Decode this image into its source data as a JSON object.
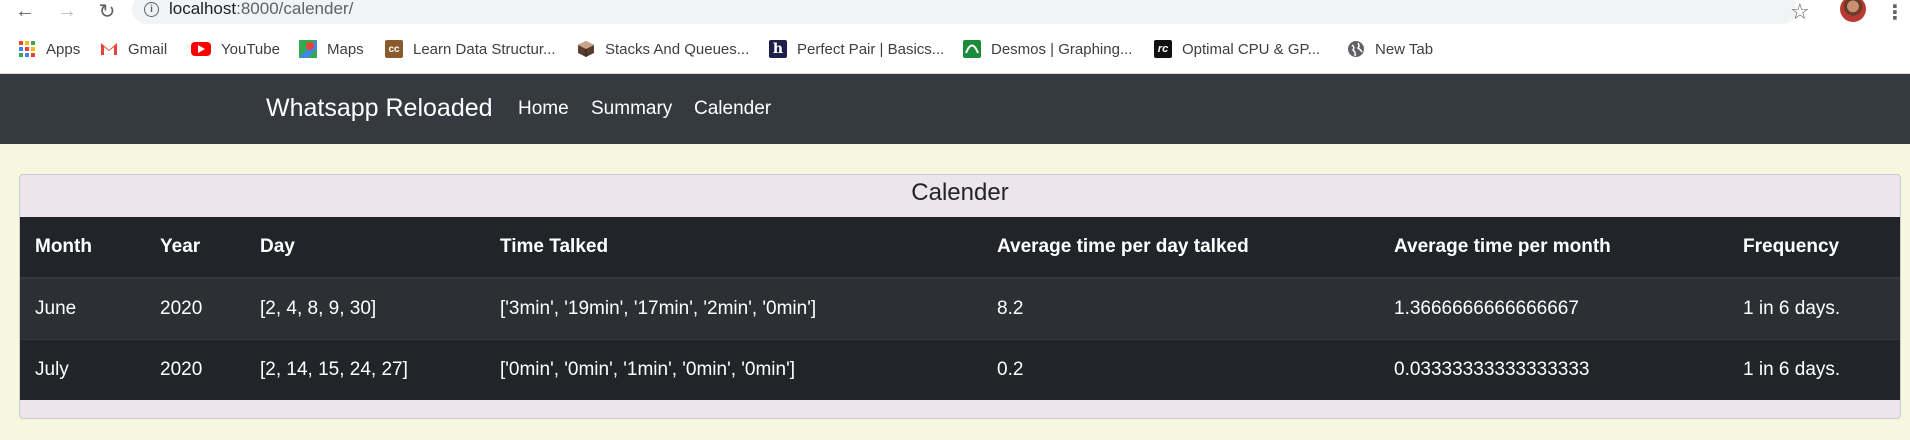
{
  "browser": {
    "url_host": "localhost",
    "url_rest": ":8000/calender/",
    "bookmarks": [
      {
        "label": "Apps",
        "icon": "apps-grid-icon"
      },
      {
        "label": "Gmail",
        "icon": "gmail-icon"
      },
      {
        "label": "YouTube",
        "icon": "youtube-icon"
      },
      {
        "label": "Maps",
        "icon": "maps-icon"
      },
      {
        "label": "Learn Data Structur...",
        "icon": "cc-icon"
      },
      {
        "label": "Stacks And Queues...",
        "icon": "cube-icon"
      },
      {
        "label": "Perfect Pair | Basics...",
        "icon": "hackerrank-icon"
      },
      {
        "label": "Desmos | Graphing...",
        "icon": "desmos-icon"
      },
      {
        "label": "Optimal CPU & GP...",
        "icon": "rc-icon"
      },
      {
        "label": "New Tab",
        "icon": "globe-icon"
      }
    ]
  },
  "navbar": {
    "brand": "Whatsapp Reloaded",
    "links": [
      "Home",
      "Summary",
      "Calender"
    ]
  },
  "card": {
    "title": "Calender",
    "headers": [
      "Month",
      "Year",
      "Day",
      "Time Talked",
      "Average time per day talked",
      "Average time per month",
      "Frequency"
    ],
    "rows": [
      [
        "June",
        "2020",
        "[2, 4, 8, 9, 30]",
        "['3min', '19min', '17min', '2min', '0min']",
        "8.2",
        "1.3666666666666667",
        "1 in 6 days."
      ],
      [
        "July",
        "2020",
        "[2, 14, 15, 24, 27]",
        "['0min', '0min', '1min', '0min', '0min']",
        "0.2",
        "0.03333333333333333",
        "1 in 6 days."
      ]
    ]
  },
  "colors": {
    "page_bg": "#f5f7de",
    "navbar_bg": "#343a40",
    "table_dark": "#212529",
    "row_stripe": "#2c3034",
    "card_bg": "#ece5ea"
  }
}
